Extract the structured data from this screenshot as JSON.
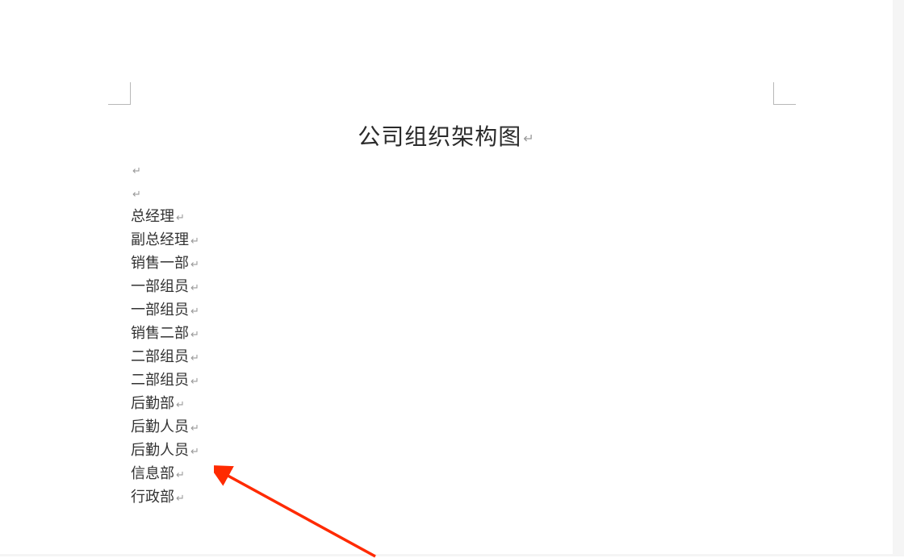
{
  "title": "公司组织架构图",
  "empty_lines": 2,
  "lines": [
    "总经理",
    "副总经理",
    "销售一部",
    "一部组员",
    "一部组员",
    "销售二部",
    "二部组员",
    "二部组员",
    "后勤部",
    "后勤人员",
    "后勤人员",
    "信息部",
    "行政部"
  ],
  "paragraph_mark": "↵",
  "arrow_color": "#ff2a00"
}
